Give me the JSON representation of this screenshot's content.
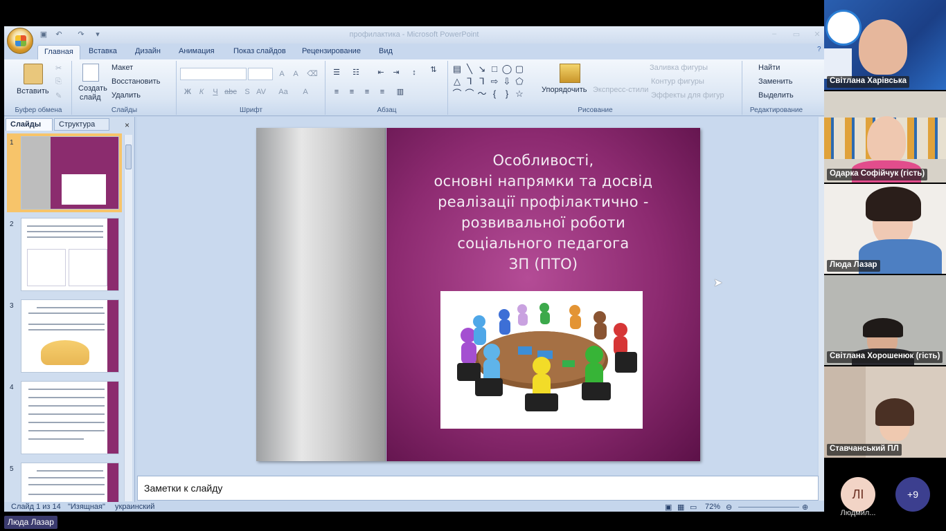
{
  "window": {
    "title": "профилактика - Microsoft PowerPoint"
  },
  "ribbon": {
    "tabs": [
      "Главная",
      "Вставка",
      "Дизайн",
      "Анимация",
      "Показ слайдов",
      "Рецензирование",
      "Вид"
    ],
    "active_tab": "Главная",
    "clipboard": {
      "paste": "Вставить",
      "label": "Буфер обмена"
    },
    "slides": {
      "new_slide_1": "Создать",
      "new_slide_2": "слайд",
      "layout": "Макет",
      "reset": "Восстановить",
      "delete": "Удалить",
      "label": "Слайды"
    },
    "font": {
      "label": "Шрифт"
    },
    "paragraph": {
      "label": "Абзац"
    },
    "drawing": {
      "arrange": "Упорядочить",
      "quick_styles": "Экспресс-стили",
      "fill": "Заливка фигуры",
      "outline": "Контур фигуры",
      "effects": "Эффекты для фигур",
      "label": "Рисование"
    },
    "editing": {
      "find": "Найти",
      "replace": "Заменить",
      "select": "Выделить",
      "label": "Редактирование"
    }
  },
  "panel": {
    "tabs": [
      "Слайды",
      "Структура"
    ],
    "close": "×",
    "slide_numbers": [
      "1",
      "2",
      "3",
      "4",
      "5"
    ]
  },
  "slide": {
    "title_lines": [
      "Особливості,",
      "основні напрямки та досвід",
      "реалізації профілактично -",
      "розвивальної роботи",
      "соціального педагога",
      "ЗП (ПТО)"
    ]
  },
  "notes": {
    "placeholder": "Заметки к слайду"
  },
  "statusbar": {
    "slide_info": "Слайд 1 из 14",
    "theme": "\"Изящная\"",
    "language": "украинский",
    "zoom": "72%"
  },
  "participants": [
    {
      "name": "Світлана Харівська"
    },
    {
      "name": "Одарка Софійчук (гість)"
    },
    {
      "name": "Люда Лазар"
    },
    {
      "name": "Світлана Хорошенюк (гість)"
    },
    {
      "name": "Ставчанський ПЛ"
    }
  ],
  "presenter_chip": "Люда Лазар",
  "avatar": {
    "initials": "ЛІ",
    "name": "Людмил..."
  },
  "more_participants": "+9"
}
